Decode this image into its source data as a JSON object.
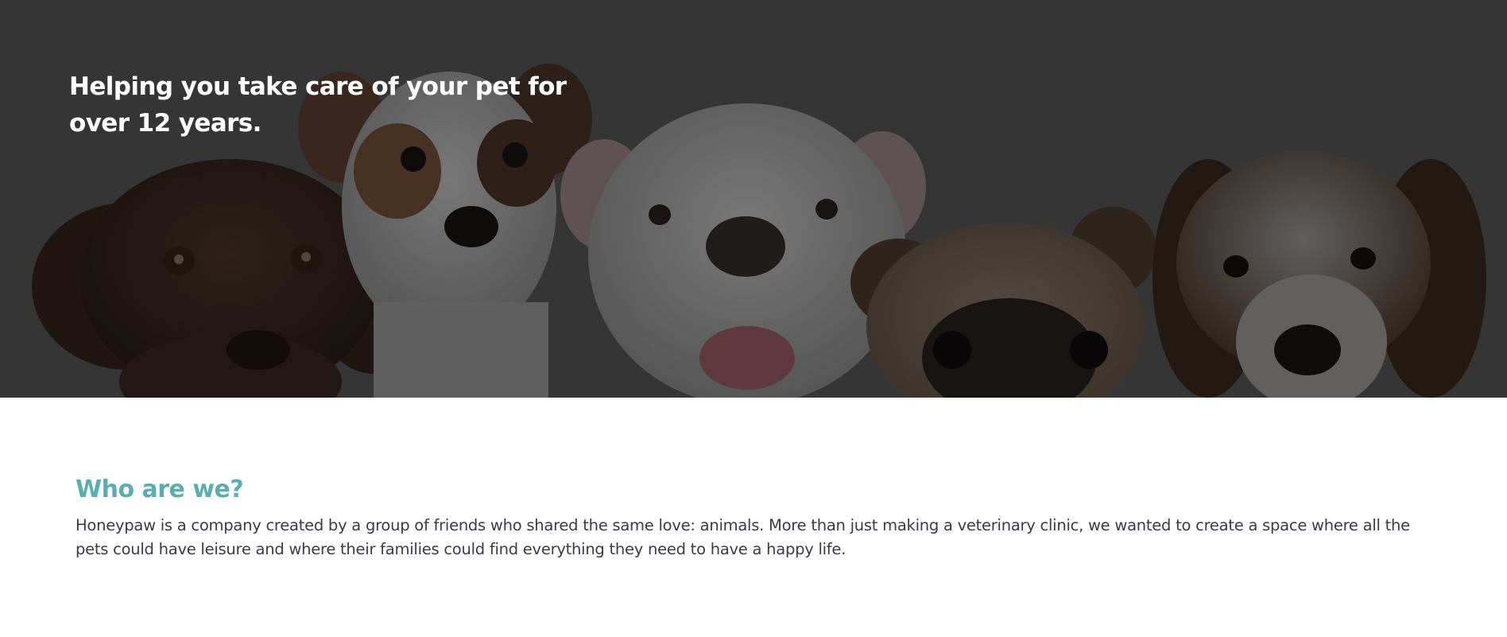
{
  "hero": {
    "title": "Helping you take care of your pet for over 12 years.",
    "image_icon": "dogs-photo"
  },
  "about": {
    "heading": "Who are we?",
    "text": "Honeypaw is a company created by a group of friends who shared the same love: animals. More than just making a veterinary clinic, we wanted to create a space where all the pets could have leisure and where their families could find everything they need to have a happy life."
  },
  "colors": {
    "hero_bg": "#4a4a4a",
    "accent": "#5aaeb0",
    "body_text": "#3a3a4a"
  }
}
